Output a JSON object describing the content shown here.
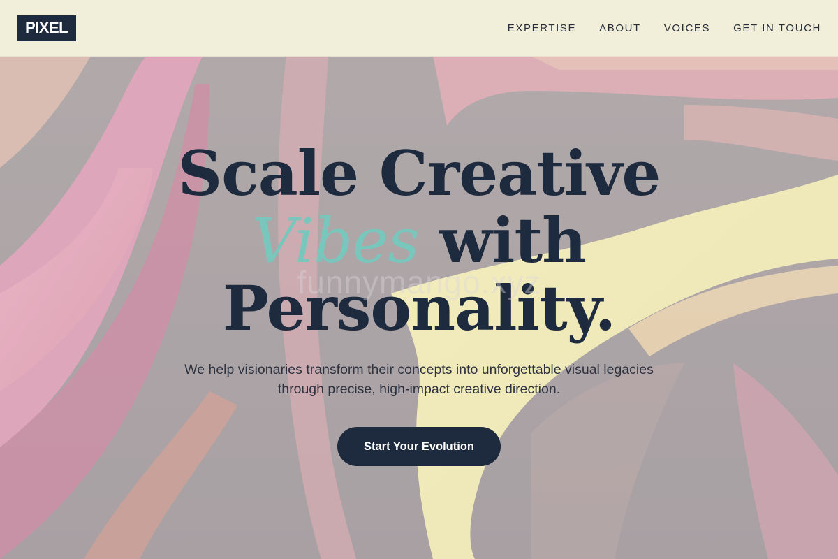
{
  "brand": {
    "logo_text": "PIXEL"
  },
  "nav": {
    "items": [
      {
        "label": "EXPERTISE"
      },
      {
        "label": "ABOUT"
      },
      {
        "label": "VOICES"
      },
      {
        "label": "GET IN TOUCH"
      }
    ]
  },
  "hero": {
    "headline_line1": "Scale Creative",
    "headline_accent": "Vibes",
    "headline_line2_rest": " with",
    "headline_line3": "Personality.",
    "subtitle": "We help visionaries transform their concepts into unforgettable visual legacies through precise, high-impact creative direction.",
    "cta_label": "Start Your Evolution",
    "watermark": "funnymango.xyz"
  },
  "colors": {
    "navy": "#1e2a3e",
    "accent_teal": "#79c7bc",
    "nav_bg": "#f4f3dc",
    "bg_pink": "#e8a2c2",
    "bg_yellow": "#f3efb0",
    "bg_gray": "#9a8f98"
  }
}
